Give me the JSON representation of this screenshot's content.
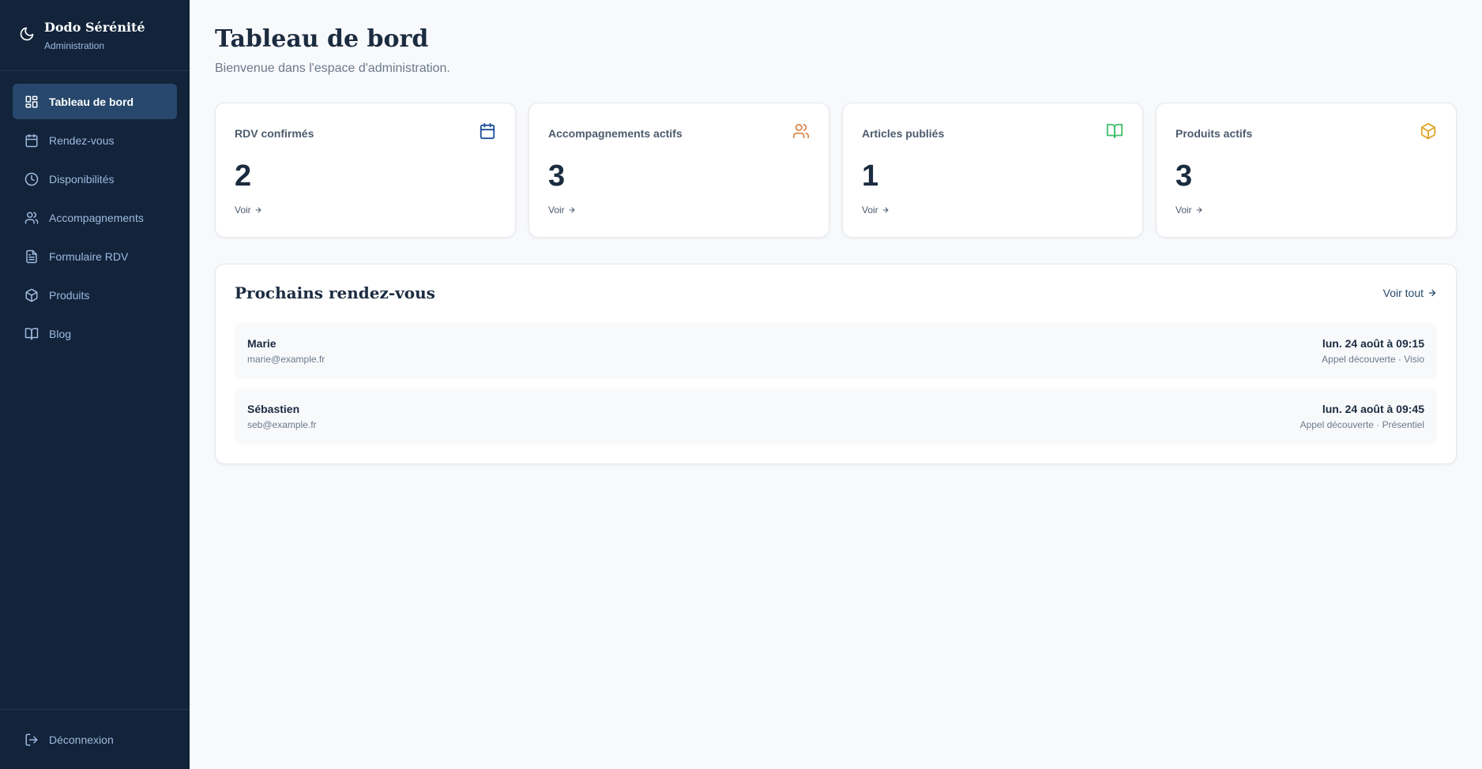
{
  "brand": {
    "title": "Dodo Sérénité",
    "subtitle": "Administration"
  },
  "sidebar": {
    "items": [
      {
        "label": "Tableau de bord",
        "icon": "dashboard-icon",
        "active": true
      },
      {
        "label": "Rendez-vous",
        "icon": "calendar-icon"
      },
      {
        "label": "Disponibilités",
        "icon": "clock-icon"
      },
      {
        "label": "Accompagnements",
        "icon": "users-icon"
      },
      {
        "label": "Formulaire RDV",
        "icon": "document-icon"
      },
      {
        "label": "Produits",
        "icon": "package-icon"
      },
      {
        "label": "Blog",
        "icon": "book-icon"
      }
    ],
    "logout_label": "Déconnexion"
  },
  "header": {
    "title": "Tableau de bord",
    "subtitle": "Bienvenue dans l'espace d'administration."
  },
  "stats": [
    {
      "label": "RDV confirmés",
      "value": "2",
      "link": "Voir",
      "icon": "calendar-icon",
      "color": "#1d4e9a"
    },
    {
      "label": "Accompagnements actifs",
      "value": "3",
      "link": "Voir",
      "icon": "users-icon",
      "color": "#d9894e"
    },
    {
      "label": "Articles publiés",
      "value": "1",
      "link": "Voir",
      "icon": "book-icon",
      "color": "#3fbf6a"
    },
    {
      "label": "Produits actifs",
      "value": "3",
      "link": "Voir",
      "icon": "package-icon",
      "color": "#e0a526"
    }
  ],
  "appointments": {
    "title": "Prochains rendez-vous",
    "see_all": "Voir tout",
    "items": [
      {
        "name": "Marie",
        "email": "marie@example.fr",
        "date": "lun. 24 août à 09:15",
        "type": "Appel découverte · Visio"
      },
      {
        "name": "Sébastien",
        "email": "seb@example.fr",
        "date": "lun. 24 août à 09:45",
        "type": "Appel découverte · Présentiel"
      }
    ]
  },
  "colors": {
    "sidebar_bg": "#12233a",
    "sidebar_active": "#27486c",
    "sidebar_text": "#9fbbe0",
    "page_bg": "#f8f9fb"
  }
}
